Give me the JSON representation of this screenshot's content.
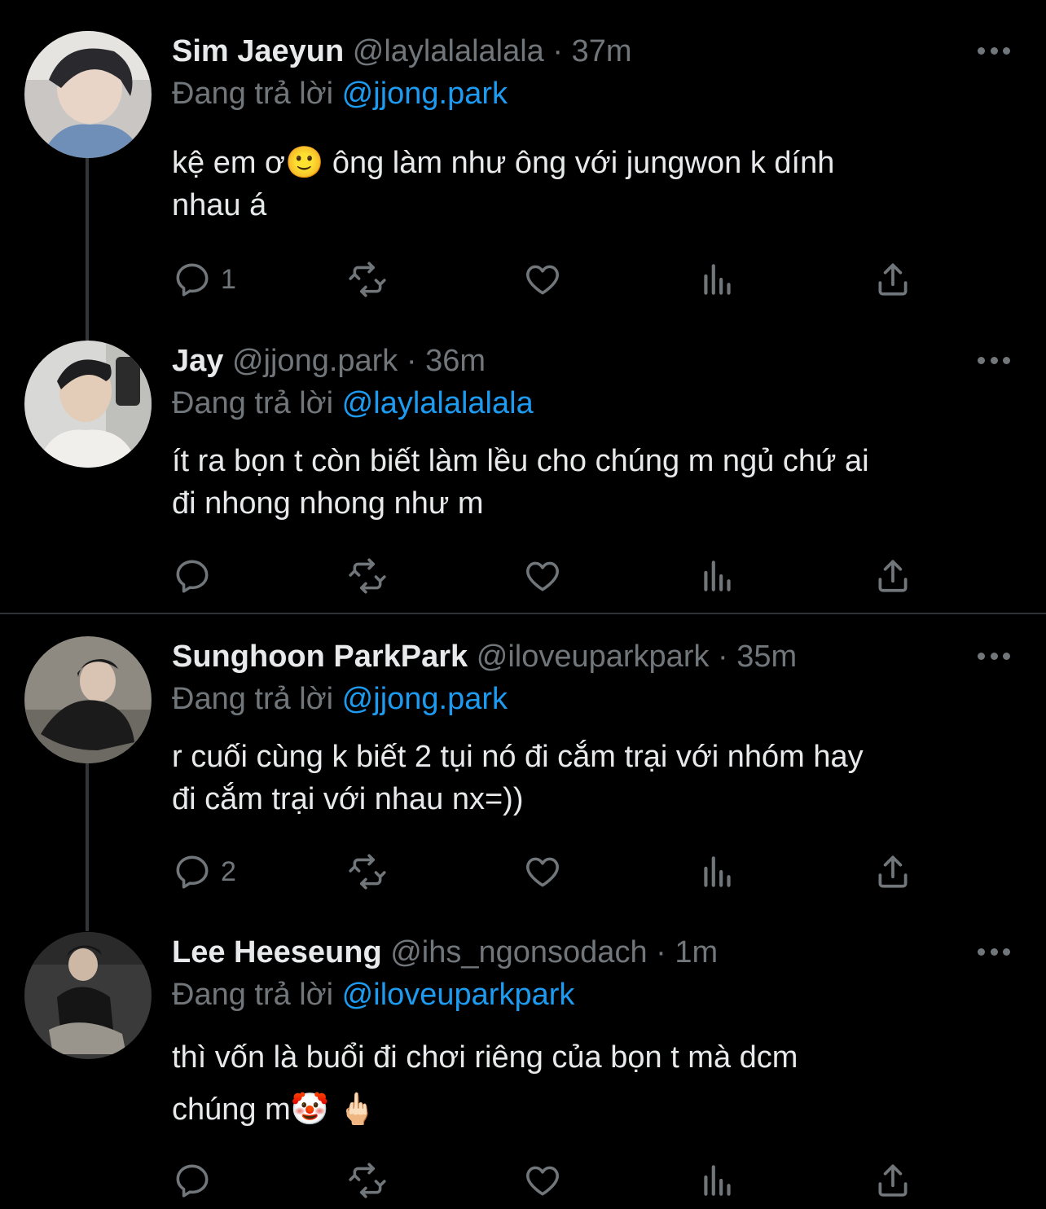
{
  "reply_prefix": "Đang trả lời",
  "tweets": [
    {
      "name": "Sim Jaeyun",
      "handle": "@laylalalalala",
      "sep": "·",
      "time": "37m",
      "reply_to": "@jjong.park",
      "text_line1": "kệ em ơ🙂  ông làm như ông với jungwon k dính",
      "text_line2": "nhau á",
      "reply_count": "1",
      "avatar_colors": [
        "#c9c6c4",
        "#2a2a2e",
        "#6f8fb8"
      ]
    },
    {
      "name": "Jay",
      "handle": "@jjong.park",
      "sep": "·",
      "time": "36m",
      "reply_to": "@laylalalalala",
      "text_line1": "ít ra bọn t còn biết làm lều cho chúng m ngủ chứ ai",
      "text_line2": "đi nhong nhong như m",
      "reply_count": "",
      "avatar_colors": [
        "#d8d8d6",
        "#1e1e20",
        "#f0efeb"
      ]
    },
    {
      "name": "Sunghoon ParkPark",
      "handle": "@iloveuparkpark",
      "sep": "·",
      "time": "35m",
      "reply_to": "@jjong.park",
      "text_line1": "r cuối cùng k biết 2 tụi nó đi cắm trại với nhóm hay",
      "text_line2": "đi cắm trại với nhau nx=))",
      "reply_count": "2",
      "avatar_colors": [
        "#8e8a82",
        "#1b1b1b",
        "#5a554e"
      ]
    },
    {
      "name": "Lee Heeseung",
      "handle": "@ihs_ngonsodach",
      "sep": "·",
      "time": "1m",
      "reply_to": "@iloveuparkpark",
      "text_line1": "thì vốn là buổi đi chơi riêng của bọn t mà dcm",
      "text_line2": "chúng m🤡 🖕🏻",
      "reply_count": "",
      "avatar_colors": [
        "#3a3a3a",
        "#151515",
        "#9a958c"
      ]
    }
  ]
}
